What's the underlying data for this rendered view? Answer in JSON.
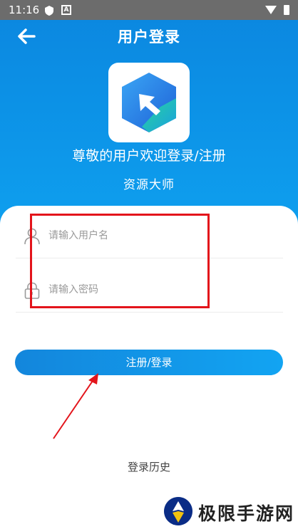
{
  "status_bar": {
    "time": "11:16",
    "icons": [
      "shield-icon",
      "a-badge-icon",
      "wifi-icon",
      "battery-icon"
    ]
  },
  "header": {
    "title": "用户登录",
    "back_icon": "arrow-left-icon"
  },
  "welcome_text": "尊敬的用户欢迎登录/注册",
  "app_name": "资源大师",
  "form": {
    "username_placeholder": "请输入用户名",
    "password_placeholder": "请输入密码",
    "submit_label": "注册/登录"
  },
  "history_label": "登录历史",
  "watermark": {
    "text": "极限手游网"
  },
  "colors": {
    "accent": "#0b86df",
    "highlight": "#e3141b"
  }
}
